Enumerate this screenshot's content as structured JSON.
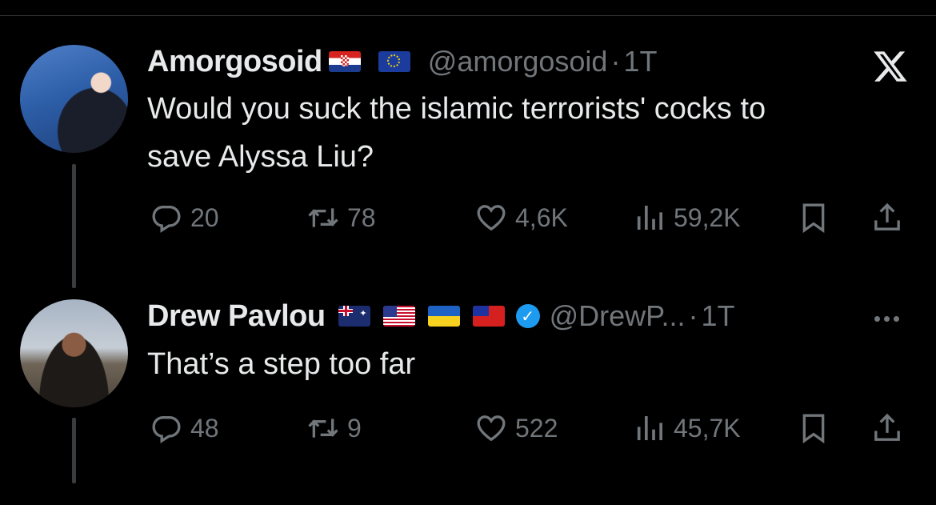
{
  "tweets": [
    {
      "name": "Amorgosoid",
      "handle": "@amorgosoid",
      "separator": "·",
      "time": "1T",
      "flags": [
        "croatia-flag",
        "eu-flag"
      ],
      "text_lines": [
        "Would you suck the islamic terrorists' cocks to",
        "save Alyssa Liu?"
      ],
      "replies": "20",
      "reposts": "78",
      "likes": "4,6K",
      "views": "59,2K"
    },
    {
      "name": "Drew Pavlou",
      "handle": "@DrewP...",
      "separator": "·",
      "time": "1T",
      "flags": [
        "australia-flag",
        "usa-flag",
        "ukraine-flag",
        "taiwan-flag"
      ],
      "verified": true,
      "text_lines": [
        "That’s a step too far"
      ],
      "replies": "48",
      "reposts": "9",
      "likes": "522",
      "views": "45,7K"
    }
  ],
  "icons": {
    "x_logo": "x-logo-icon",
    "reply": "reply-icon",
    "repost": "repost-icon",
    "like": "heart-icon",
    "views": "views-icon",
    "bookmark": "bookmark-icon",
    "share": "share-icon",
    "more": "more-icon",
    "verified": "verified-badge-icon"
  },
  "colors": {
    "background": "#000000",
    "text": "#e7e9ea",
    "secondary": "#71767b",
    "verified": "#1d9bf0"
  }
}
